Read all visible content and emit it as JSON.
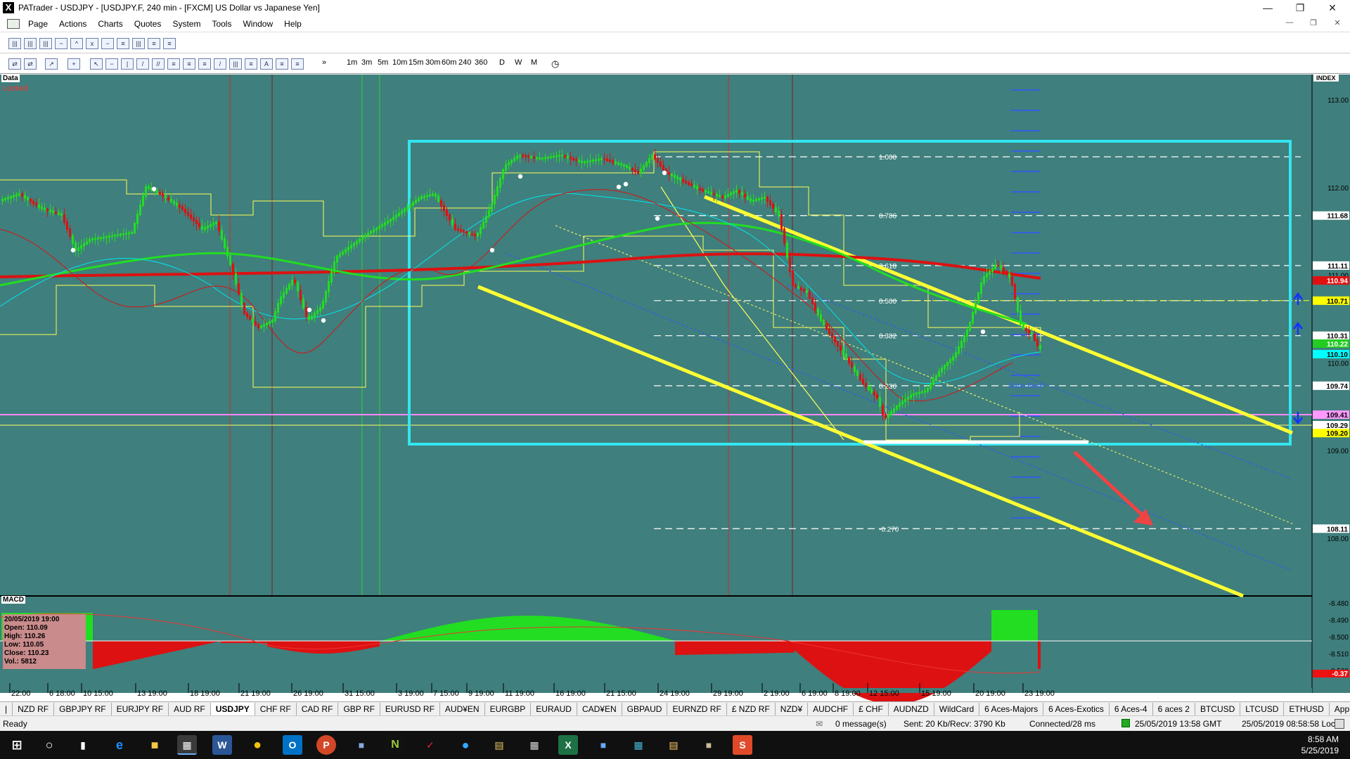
{
  "window": {
    "title": "PATrader - USDJPY - [USDJPY.F, 240 min - [FXCM] US Dollar vs Japanese Yen]",
    "app_icon": "X"
  },
  "menu": [
    "Page",
    "Actions",
    "Charts",
    "Quotes",
    "System",
    "Tools",
    "Window",
    "Help"
  ],
  "timeframes": [
    "1m",
    "3m",
    "5m",
    "10m",
    "15m",
    "30m",
    "60m",
    "240",
    "360",
    "D",
    "W",
    "M"
  ],
  "chart": {
    "data_label": "Data",
    "locked_label": "Locked",
    "index_label": "INDEX",
    "gann_label": "Gann Base",
    "macd_label": "MACD",
    "price_ticks": [
      {
        "label": "113.00",
        "v": 113.0
      },
      {
        "label": "112.00",
        "v": 112.0
      },
      {
        "label": "111.00",
        "v": 111.0
      },
      {
        "label": "110.00",
        "v": 110.0
      },
      {
        "label": "109.00",
        "v": 109.0
      },
      {
        "label": "108.00",
        "v": 108.0
      }
    ],
    "price_tags": [
      {
        "label": "111.68",
        "v": 111.68,
        "bg": "#ffffff",
        "fg": "#000000"
      },
      {
        "label": "111.11",
        "v": 111.11,
        "bg": "#ffffff",
        "fg": "#000000"
      },
      {
        "label": "110.94",
        "v": 110.94,
        "bg": "#e01010",
        "fg": "#ffffff"
      },
      {
        "label": "110.71",
        "v": 110.71,
        "bg": "#ffff00",
        "fg": "#000000"
      },
      {
        "label": "110.31",
        "v": 110.31,
        "bg": "#ffffff",
        "fg": "#000000"
      },
      {
        "label": "110.22",
        "v": 110.22,
        "bg": "#22cc22",
        "fg": "#ffffff"
      },
      {
        "label": "110.10",
        "v": 110.1,
        "bg": "#00ffff",
        "fg": "#000000"
      },
      {
        "label": "109.74",
        "v": 109.74,
        "bg": "#ffffff",
        "fg": "#000000"
      },
      {
        "label": "109.41",
        "v": 109.41,
        "bg": "#ff99ff",
        "fg": "#000000"
      },
      {
        "label": "109.29",
        "v": 109.29,
        "bg": "#ffffff",
        "fg": "#000000"
      },
      {
        "label": "109.20",
        "v": 109.2,
        "bg": "#ffff00",
        "fg": "#000000"
      },
      {
        "label": "108.11",
        "v": 108.11,
        "bg": "#ffffff",
        "fg": "#000000"
      }
    ],
    "fib_levels": [
      {
        "label": "1.000",
        "v": 112.35
      },
      {
        "label": "0.786",
        "v": 111.68
      },
      {
        "label": "0.618",
        "v": 111.11
      },
      {
        "label": "0.500",
        "v": 110.71
      },
      {
        "label": "0.382",
        "v": 110.31
      },
      {
        "label": "0.236",
        "v": 109.74
      },
      {
        "label": "-0.270",
        "v": 108.11
      }
    ],
    "macd_ticks": [
      {
        "label": "-8.480",
        "v": -8.48
      },
      {
        "label": "-8.490",
        "v": -8.49
      },
      {
        "label": "-8.500",
        "v": -8.5
      },
      {
        "label": "-8.510",
        "v": -8.51
      },
      {
        "label": "-8.520",
        "v": -8.52
      }
    ],
    "macd_tag": "-0.37",
    "time_labels": [
      "22:00",
      "6 18:00",
      "10 15:00",
      "13 19:00",
      "18 19:00",
      "21 19:00",
      "26 19:00",
      "31 15:00",
      "3 19:00",
      "7 15:00",
      "9 19:00",
      "11 19:00",
      "16 19:00",
      "21 15:00",
      "24 19:00",
      "29 19:00",
      "2 19:00",
      "6 19:00",
      "8 19:00",
      "12 15:00",
      "15 19:00",
      "20 19:00",
      "23 19:00"
    ],
    "colors": {
      "background": "#3f7f7d",
      "channel": "#ffff33",
      "box": "#33e6f0",
      "ma_red": "#dd1111",
      "ma_green": "#22dd22",
      "candle_up": "#22dd22",
      "candle_down": "#dd1111"
    }
  },
  "infobox": {
    "date": "20/05/2019 19:00",
    "open": "Open: 110.09",
    "high": "High: 110.26",
    "low": "Low: 110.05",
    "close": "Close: 110.23",
    "vol": "Vol.: 5812"
  },
  "tabs": [
    "NZD RF",
    "GBPJPY RF",
    "EURJPY RF",
    "AUD RF",
    "USDJPY",
    "CHF RF",
    "CAD RF",
    "GBP RF",
    "EURUSD RF",
    "AUD¥EN",
    "EURGBP",
    "EURAUD",
    "CAD¥EN",
    "GBPAUD",
    "EURNZD RF",
    "£ NZD RF",
    "NZD¥",
    "AUDCHF",
    "£ CHF",
    "AUDNZD",
    "WildCard",
    "6 Aces-Majors",
    "6 Aces-Exotics",
    "6 Aces-4",
    "6 aces 2",
    "BTCUSD",
    "LTCUSD",
    "ETHUSD",
    "Apple"
  ],
  "active_tab": "USDJPY",
  "status": {
    "ready": "Ready",
    "messages": "0 message(s)",
    "sent": "Sent: 20 Kb/Recv: 3790 Kb",
    "connected": "Connected/28 ms",
    "gmt": "25/05/2019 13:58 GMT",
    "local": "25/05/2019 08:58:58 Local"
  },
  "taskbar": {
    "time": "8:58 AM",
    "date": "5/25/2019"
  }
}
